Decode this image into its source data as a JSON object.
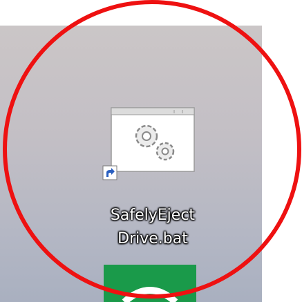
{
  "desktop": {
    "shortcut": {
      "label_line1": "SafelyEject",
      "label_line2": "Drive.bat",
      "icon": "batch-file-gears-icon",
      "overlay_icon": "shortcut-arrow-icon"
    },
    "partial_app_icon": "green-app-icon"
  },
  "annotation": {
    "shape": "circle",
    "color": "#ee1111"
  },
  "colors": {
    "desktop_top": "#cbc6c7",
    "desktop_bottom": "#a9b0c0",
    "label_text": "#ffffff",
    "app_green": "#1a9a4a"
  }
}
